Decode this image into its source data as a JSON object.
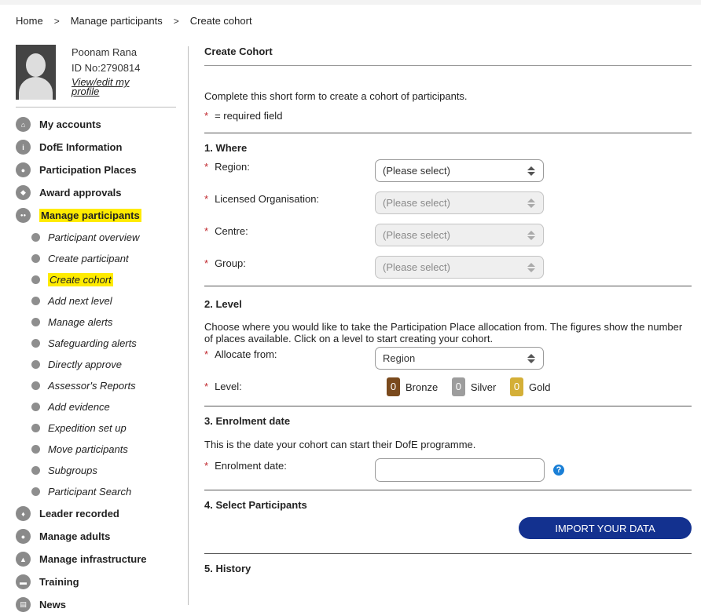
{
  "breadcrumb": [
    "Home",
    "Manage participants",
    "Create cohort"
  ],
  "breadcrumb_sep": ">",
  "profile": {
    "name": "Poonam Rana",
    "id": "ID No:2790814",
    "edit_link": "View/edit my profile"
  },
  "nav_top": [
    {
      "label": "My accounts",
      "icon": "home-icon",
      "glyph": "⌂"
    },
    {
      "label": "DofE Information",
      "icon": "info-icon",
      "glyph": "i"
    },
    {
      "label": "Participation Places",
      "icon": "person-icon",
      "glyph": "●"
    },
    {
      "label": "Award approvals",
      "icon": "shield-icon",
      "glyph": "◆"
    },
    {
      "label": "Manage participants",
      "icon": "people-icon",
      "glyph": "●●"
    }
  ],
  "nav_sub": [
    "Participant overview",
    "Create participant",
    "Create cohort",
    "Add next level",
    "Manage alerts",
    "Safeguarding alerts",
    "Directly approve",
    "Assessor's Reports",
    "Add evidence",
    "Expedition set up",
    "Move participants",
    "Subgroups",
    "Participant Search"
  ],
  "nav_bottom": [
    {
      "label": "Leader recorded",
      "icon": "leader-icon",
      "glyph": "♦"
    },
    {
      "label": "Manage adults",
      "icon": "adults-icon",
      "glyph": "●"
    },
    {
      "label": "Manage infrastructure",
      "icon": "infrastructure-icon",
      "glyph": "▲"
    },
    {
      "label": "Training",
      "icon": "training-icon",
      "glyph": "▬"
    },
    {
      "label": "News",
      "icon": "news-icon",
      "glyph": "▤"
    }
  ],
  "page": {
    "title": "Create Cohort",
    "intro": "Complete this short form to create a cohort of participants.",
    "required_note": "= required field",
    "required_mark": "*"
  },
  "where": {
    "title": "1. Where",
    "region_label": "Region:",
    "region_value": "(Please select)",
    "org_label": "Licensed Organisation:",
    "org_value": "(Please select)",
    "centre_label": "Centre:",
    "centre_value": "(Please select)",
    "group_label": "Group:",
    "group_value": "(Please select)"
  },
  "level": {
    "title": "2. Level",
    "desc": "Choose where you would like to take the Participation Place allocation from. The figures show the number of places available. Click on a level to start creating your cohort.",
    "allocate_label": "Allocate from:",
    "allocate_value": "Region",
    "level_label": "Level:",
    "levels": [
      {
        "count": "0",
        "name": "Bronze",
        "color": "#7a4a1d"
      },
      {
        "count": "0",
        "name": "Silver",
        "color": "#9d9d9d"
      },
      {
        "count": "0",
        "name": "Gold",
        "color": "#d4af37"
      }
    ]
  },
  "enrolment": {
    "title": "3. Enrolment date",
    "desc": "This is the date your cohort can start their DofE programme.",
    "date_label": "Enrolment date:",
    "date_value": "",
    "help_glyph": "?"
  },
  "select_participants": {
    "title": "4. Select Participants",
    "import_button": "IMPORT YOUR DATA"
  },
  "history": {
    "title": "5. History"
  },
  "colors": {
    "highlight": "#ffeb00",
    "required": "#c0272d",
    "primary_button": "#13318f",
    "help": "#1a7fd6"
  }
}
